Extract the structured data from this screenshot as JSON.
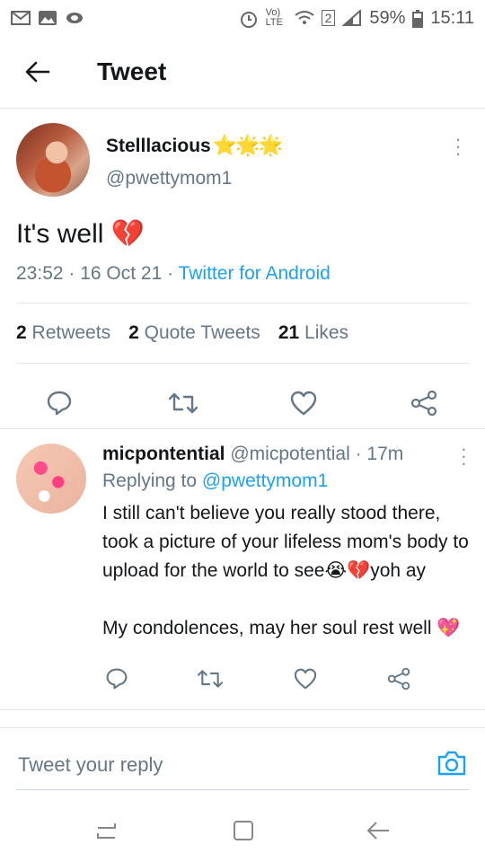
{
  "status_bar": {
    "battery": "59%",
    "time": "15:11",
    "volte": "Vo) LTE",
    "sim": "2"
  },
  "app_bar": {
    "title": "Tweet"
  },
  "main_tweet": {
    "display_name": "Stelllacious",
    "display_name_emoji": "⭐🌟🌟",
    "handle": "@pwettymom1",
    "text": "It's well",
    "emoji": "💔",
    "time": "23:52",
    "date": "16 Oct 21",
    "source": "Twitter for Android",
    "stats": {
      "retweets_count": "2",
      "retweets_label": "Retweets",
      "quotes_count": "2",
      "quotes_label": "Quote Tweets",
      "likes_count": "21",
      "likes_label": "Likes"
    }
  },
  "reply": {
    "display_name": "micpontential",
    "handle": "@micpotential",
    "age": "17m",
    "replying_to_label": "Replying to",
    "replying_to_handle": "@pwettymom1",
    "body_line1": "I still can't believe you really stood there, took a picture of your lifeless mom's body to upload for the world to see",
    "body_emoji1": "😭💔",
    "body_line1_end": "yoh ay",
    "body_line2": "My condolences, may her soul rest well",
    "body_emoji2": "💖"
  },
  "reply_bar": {
    "placeholder": "Tweet your reply"
  },
  "icons": {
    "accent": "#1da1f2",
    "secondary_text": "#657786"
  }
}
